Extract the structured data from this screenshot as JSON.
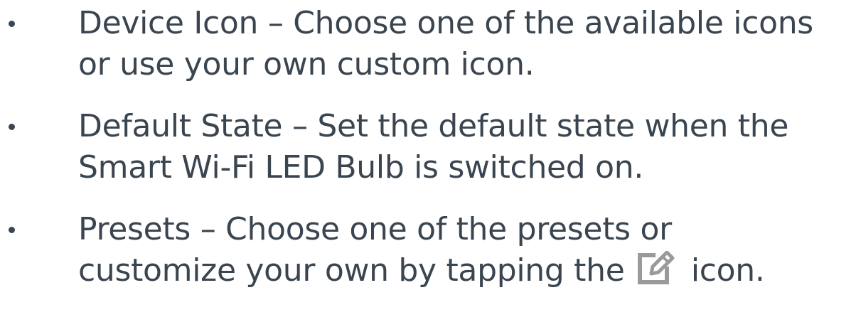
{
  "bullets": [
    {
      "line1": "Device Icon – Choose one of the available icons",
      "line2": "or use your own custom icon."
    },
    {
      "line1": "Default State – Set the default state when the",
      "line2": "Smart Wi-Fi LED Bulb is switched on."
    },
    {
      "line1": "Presets – Choose one of the presets or",
      "line2_before_icon": "customize your own by tapping the",
      "icon": "edit-pencil-icon",
      "line2_after_icon": "icon."
    }
  ],
  "colors": {
    "text": "#3a4550",
    "icon": "#9a9a9a"
  }
}
